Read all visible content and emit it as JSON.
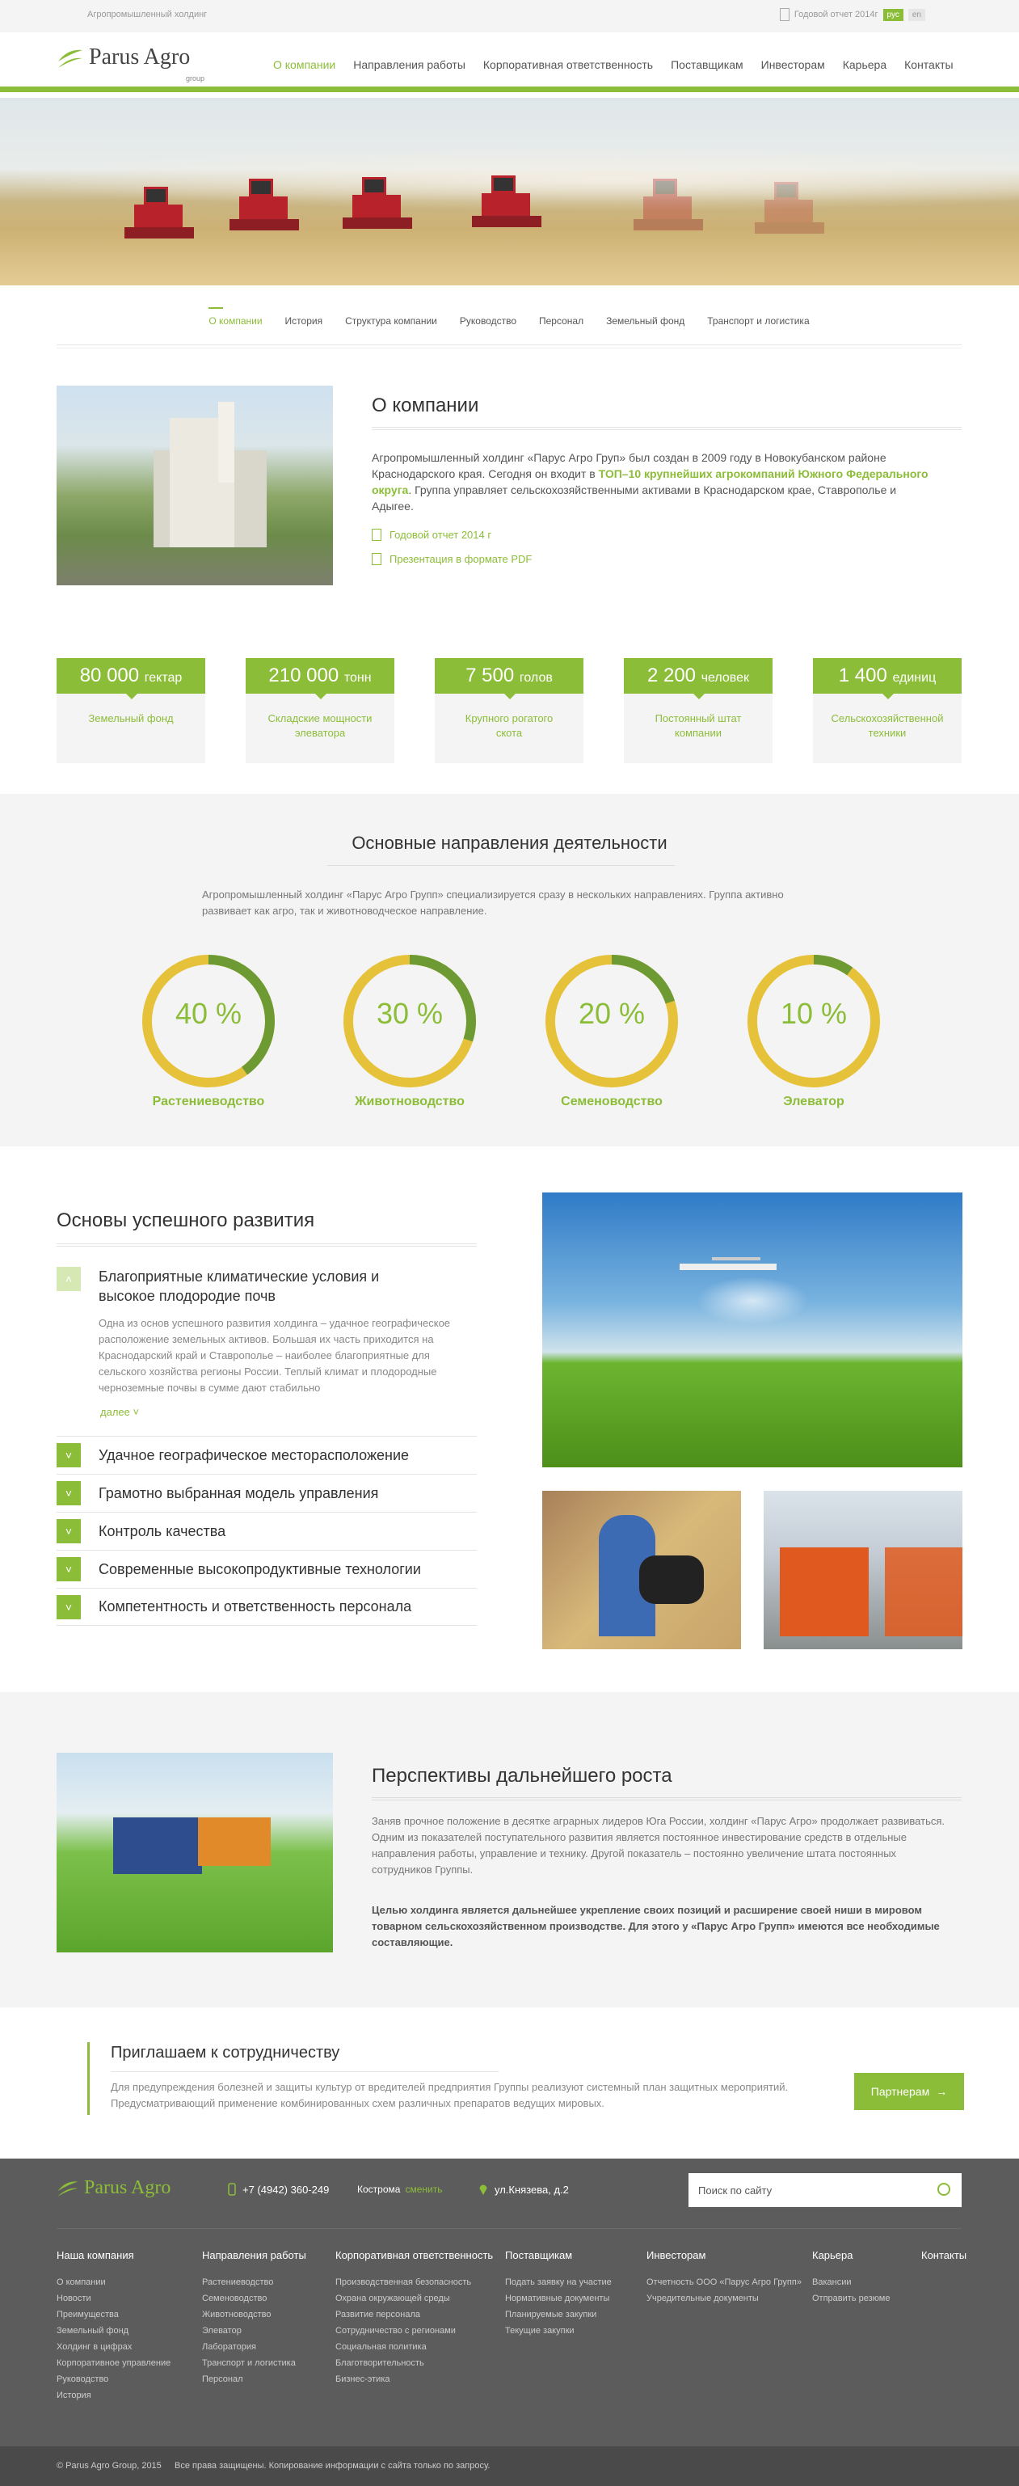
{
  "topbar": {
    "left": "Агропромышленный холдинг",
    "report": "Годовой отчет 2014г",
    "langs": [
      "рус",
      "en"
    ]
  },
  "logo": {
    "name": "Parus Agro",
    "group": "group"
  },
  "menu": [
    "О компании",
    "Направления работы",
    "Корпоративная ответственность",
    "Поставщикам",
    "Инвесторам",
    "Карьера",
    "Контакты"
  ],
  "subnav": [
    "О компании",
    "История",
    "Структура компании",
    "Руководство",
    "Персонал",
    "Земельный фонд",
    "Транспорт и логистика"
  ],
  "about": {
    "title": "О компании",
    "text1": "Агропромышленный холдинг «Парус Агро Груп» был создан в 2009 году в Новокубанском районе Краснодарского края. Сегодня он входит в ",
    "bold": "ТОП–10 крупнейших агрокомпаний Южного Федерального округа",
    "text2": ". Группа управляет сельскохозяйственными активами в Краснодарском крае, Ставрополье и Адыгее.",
    "link1": "Годовой отчет 2014 г",
    "link2": "Презентация в формате PDF"
  },
  "stats": [
    {
      "num": "80 000",
      "unit": "гектар",
      "cap": "Земельный фонд"
    },
    {
      "num": "210 000",
      "unit": "тонн",
      "cap": "Складские мощности элеватора"
    },
    {
      "num": "7 500",
      "unit": "голов",
      "cap": "Крупного рогатого скота"
    },
    {
      "num": "2 200",
      "unit": "человек",
      "cap": "Постоянный штат компании"
    },
    {
      "num": "1 400",
      "unit": "единиц",
      "cap": "Сельскохозяйственной техники"
    }
  ],
  "directions": {
    "title": "Основные направления деятельности",
    "text": "Агропромышленный холдинг «Парус Агро Групп» специализируется сразу в нескольких направлениях. Группа активно развивает как агро, так и животноводческое направление.",
    "items": [
      {
        "label": "Растениеводство",
        "value": "40 %",
        "pct": 40
      },
      {
        "label": "Животноводство",
        "value": "30 %",
        "pct": 30
      },
      {
        "label": "Семеноводство",
        "value": "20 %",
        "pct": 20
      },
      {
        "label": "Элеватор",
        "value": "10 %",
        "pct": 10
      }
    ]
  },
  "basics": {
    "title": "Основы успешного развития",
    "open_title": "Благоприятные климатические условия и высокое плодородие почв",
    "open_text": "Одна из основ успешного развития холдинга – удачное географическое расположение земельных активов. Большая их часть приходится на Краснодарский край и Ставрополье – наиболее благоприятные для сельского хозяйства регионы России. Теплый климат и плодородные черноземные почвы в сумме дают стабильно",
    "more": "далее",
    "items": [
      "Удачное географическое месторасположение",
      "Грамотно выбранная модель управления",
      "Контроль качества",
      "Современные высокопродуктивные технологии",
      "Компетентность и ответственность персонала"
    ]
  },
  "perspectives": {
    "title": "Перспективы дальнейшего роста",
    "p1": "Заняв прочное положение в десятке аграрных лидеров Юга России, холдинг «Парус Агро» продолжает развиваться. Одним из показателей поступательного развития является постоянное инвестирование средств в отдельные направления работы, управление и технику. Другой показатель – постоянно увеличение штата постоянных сотрудников Группы.",
    "p2": "Целью холдинга является дальнейшее укрепление своих позиций и расширение своей ниши в мировом товарном сельскохозяйственном производстве. Для этого у «Парус Агро Групп» имеются все необходимые составляющие."
  },
  "invite": {
    "title": "Приглашаем к сотрудничеству",
    "text": "Для предупреждения болезней и защиты культур от вредителей предприятия Группы реализуют системный план защитных мероприятий. Предусматривающий применение комбинированных схем различных препаратов ведущих мировых.",
    "button": "Партнерам",
    "arrow": "→"
  },
  "footer": {
    "phone": "+7 (4942) 360-249",
    "city": "Кострома",
    "change": "сменить",
    "address": "ул.Князева, д.2",
    "search_placeholder": "Поиск по сайту",
    "cols": [
      {
        "h": "Наша компания",
        "items": [
          "О компании",
          "Новости",
          "Преимущества",
          "Земельный фонд",
          "Холдинг в цифрах",
          "Корпоративное управление",
          "Руководство",
          "История"
        ]
      },
      {
        "h": "Направления работы",
        "items": [
          "Растениеводство",
          "Семеноводство",
          "Животноводство",
          "Элеватор",
          "Лаборатория",
          "Транспорт и логистика",
          "Персонал"
        ]
      },
      {
        "h": "Корпоративная ответственность",
        "items": [
          "Производственная безопасность",
          "Охрана окружающей среды",
          "Развитие персонала",
          "Сотрудничество с регионами",
          "Социальная политика",
          "Благотворительность",
          "Бизнес-этика"
        ]
      },
      {
        "h": "Поставщикам",
        "items": [
          "Подать заявку на участие",
          "Нормативные документы",
          "Планируемые закупки",
          "Текущие закупки"
        ]
      },
      {
        "h": "Инвесторам",
        "items": [
          "Отчетность ООО «Парус Агро Групп»",
          "Учредительные документы"
        ]
      },
      {
        "h": "Карьера",
        "items": [
          "Вакансии",
          "Отправить резюме"
        ]
      },
      {
        "h": "Контакты",
        "items": []
      }
    ],
    "copyright": "© Parus Agro Group, 2015",
    "rights": "Все права защищены. Копирование информации с сайта  только по запросу."
  },
  "colors": {
    "accent": "#8cbd38",
    "yellow": "#e6c23a",
    "footer": "#5c5c5c"
  }
}
